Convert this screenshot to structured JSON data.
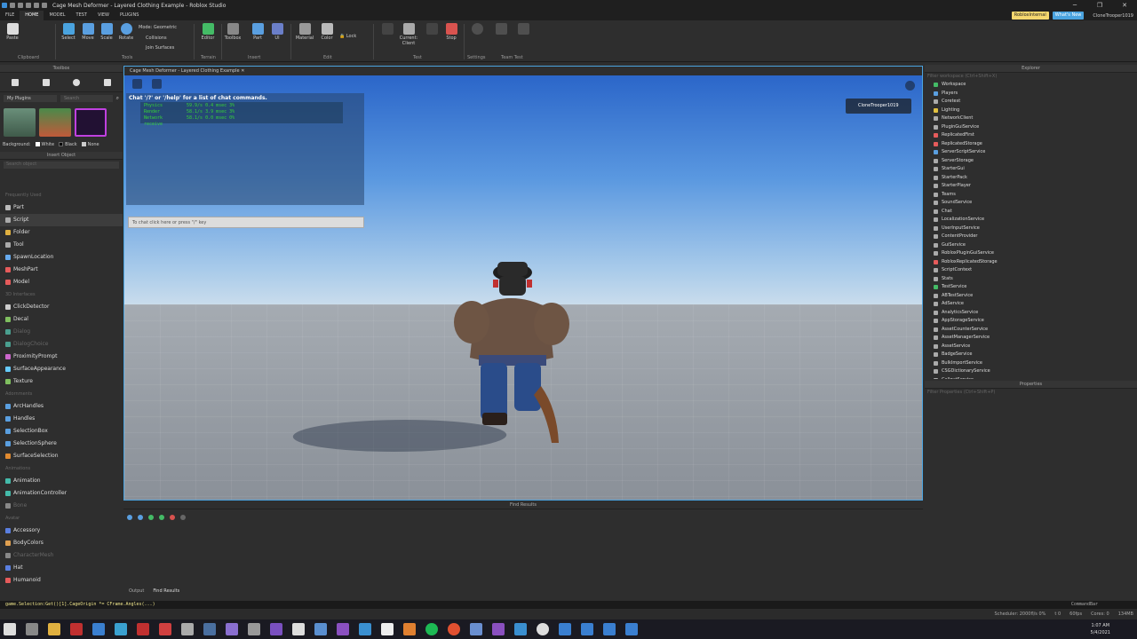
{
  "window": {
    "title": "Cage Mesh Deformer - Layered Clothing Example - Roblox Studio"
  },
  "menu": {
    "items": [
      "FILE",
      "HOME",
      "MODEL",
      "TEST",
      "VIEW",
      "PLUGINS"
    ],
    "active": "HOME",
    "badge1": "RobloxInternal",
    "badge2": "What's New",
    "user": "CloneTrooper1019"
  },
  "ribbon": {
    "paste": "Paste",
    "select": "Select",
    "move": "Move",
    "scale": "Scale",
    "rotate": "Rotate",
    "mode_label": "Mode:",
    "mode_value": "Geometric",
    "collisions": "Collisions",
    "join": "Join Surfaces",
    "editor": "Editor",
    "toolbox": "Toolbox",
    "part": "Part",
    "ui": "UI",
    "material": "Material",
    "color": "Color",
    "lock": "Lock",
    "current_client": "Current: Client",
    "stop": "Stop",
    "groups": {
      "clipboard": "Clipboard",
      "tools": "Tools",
      "terrain": "Terrain",
      "insert": "Insert",
      "edit": "Edit",
      "test": "Test",
      "settings": "Settings",
      "team_test": "Team Test"
    }
  },
  "toolbox": {
    "header": "Toolbox",
    "category": "My Plugins",
    "search_placeholder": "Search",
    "background_label": "Background:",
    "bg_options": [
      "White",
      "Black",
      "None"
    ]
  },
  "insert_object": {
    "header": "Insert Object",
    "search_placeholder": "Search object",
    "items": [
      {
        "label": "Frequently Used",
        "type": "section"
      },
      {
        "label": "Part",
        "type": "item",
        "color": "#bbbbbb"
      },
      {
        "label": "Script",
        "type": "item",
        "color": "#aaaaaa",
        "selected": true
      },
      {
        "label": "Folder",
        "type": "item",
        "color": "#e0b040"
      },
      {
        "label": "Tool",
        "type": "item",
        "color": "#aaaaaa"
      },
      {
        "label": "SpawnLocation",
        "type": "item",
        "color": "#66aaee"
      },
      {
        "label": "MeshPart",
        "type": "item",
        "color": "#e65b5b"
      },
      {
        "label": "Model",
        "type": "item",
        "color": "#e65b5b"
      },
      {
        "label": "3D Interfaces",
        "type": "section"
      },
      {
        "label": "ClickDetector",
        "type": "item",
        "color": "#cccccc"
      },
      {
        "label": "Decal",
        "type": "item",
        "color": "#7fbf5f"
      },
      {
        "label": "Dialog",
        "type": "dim",
        "color": "#4a9f8f"
      },
      {
        "label": "DialogChoice",
        "type": "dim",
        "color": "#4a9f8f"
      },
      {
        "label": "ProximityPrompt",
        "type": "item",
        "color": "#cc66cc"
      },
      {
        "label": "SurfaceAppearance",
        "type": "item",
        "color": "#66ccff"
      },
      {
        "label": "Texture",
        "type": "item",
        "color": "#7fbf5f"
      },
      {
        "label": "Adornments",
        "type": "section"
      },
      {
        "label": "ArcHandles",
        "type": "item",
        "color": "#5a9fe0"
      },
      {
        "label": "Handles",
        "type": "item",
        "color": "#5a9fe0"
      },
      {
        "label": "SelectionBox",
        "type": "item",
        "color": "#5a9fe0"
      },
      {
        "label": "SelectionSphere",
        "type": "item",
        "color": "#5a9fe0"
      },
      {
        "label": "SurfaceSelection",
        "type": "item",
        "color": "#e08a30"
      },
      {
        "label": "Animations",
        "type": "section"
      },
      {
        "label": "Animation",
        "type": "item",
        "color": "#44bbaa"
      },
      {
        "label": "AnimationController",
        "type": "item",
        "color": "#44bbaa"
      },
      {
        "label": "Bone",
        "type": "dim",
        "color": "#888888"
      },
      {
        "label": "Avatar",
        "type": "section"
      },
      {
        "label": "Accessory",
        "type": "item",
        "color": "#5a7fe0"
      },
      {
        "label": "BodyColors",
        "type": "item",
        "color": "#e0a050"
      },
      {
        "label": "CharacterMesh",
        "type": "dim",
        "color": "#888888"
      },
      {
        "label": "Hat",
        "type": "item",
        "color": "#5a7fe0"
      },
      {
        "label": "Humanoid",
        "type": "item",
        "color": "#e65b5b"
      }
    ]
  },
  "viewport": {
    "tab_title": "Cage Mesh Deformer - Layered Clothing Example",
    "chat_title": "Chat '/?' or '/help' for a list of chat commands.",
    "stats": [
      {
        "name": "Physics",
        "value": "59.9/s 0.4 msec 3%"
      },
      {
        "name": "Render",
        "value": "58.1/s 3.9 msec 3%"
      },
      {
        "name": "Network receive",
        "value": "58.1/s 0.0 msec 0%"
      }
    ],
    "chat_input": "To chat click here or press \"/\" key",
    "player_name": "CloneTrooper1019"
  },
  "find_results": {
    "header": "Find Results",
    "tabs": [
      "Output",
      "Find Results"
    ]
  },
  "explorer": {
    "header": "Explorer",
    "filter_placeholder": "Filter workspace (Ctrl+Shift+X)",
    "items": [
      {
        "label": "Workspace",
        "color": "#44bb66"
      },
      {
        "label": "Players",
        "color": "#5a9fe0"
      },
      {
        "label": "Coretest",
        "color": "#aaaaaa"
      },
      {
        "label": "Lighting",
        "color": "#e0c040"
      },
      {
        "label": "NetworkClient",
        "color": "#aaaaaa"
      },
      {
        "label": "PluginGuiService",
        "color": "#aaaaaa"
      },
      {
        "label": "ReplicatedFirst",
        "color": "#e65b5b"
      },
      {
        "label": "ReplicatedStorage",
        "color": "#e65b5b"
      },
      {
        "label": "ServerScriptService",
        "color": "#5a9fe0"
      },
      {
        "label": "ServerStorage",
        "color": "#aaaaaa"
      },
      {
        "label": "StarterGui",
        "color": "#aaaaaa"
      },
      {
        "label": "StarterPack",
        "color": "#aaaaaa"
      },
      {
        "label": "StarterPlayer",
        "color": "#aaaaaa"
      },
      {
        "label": "Teams",
        "color": "#aaaaaa"
      },
      {
        "label": "SoundService",
        "color": "#aaaaaa"
      },
      {
        "label": "Chat",
        "color": "#aaaaaa"
      },
      {
        "label": "LocalizationService",
        "color": "#aaaaaa"
      },
      {
        "label": "UserInputService",
        "color": "#aaaaaa"
      },
      {
        "label": "ContentProvider",
        "color": "#aaaaaa"
      },
      {
        "label": "GuiService",
        "color": "#aaaaaa"
      },
      {
        "label": "RobloxPluginGuiService",
        "color": "#aaaaaa"
      },
      {
        "label": "RobloxReplicatedStorage",
        "color": "#e65b5b"
      },
      {
        "label": "ScriptContext",
        "color": "#aaaaaa"
      },
      {
        "label": "Stats",
        "color": "#aaaaaa"
      },
      {
        "label": "TestService",
        "color": "#44bb66"
      },
      {
        "label": "ABTestService",
        "color": "#aaaaaa"
      },
      {
        "label": "AdService",
        "color": "#aaaaaa"
      },
      {
        "label": "AnalyticsService",
        "color": "#aaaaaa"
      },
      {
        "label": "AppStorageService",
        "color": "#aaaaaa"
      },
      {
        "label": "AssetCounterService",
        "color": "#aaaaaa"
      },
      {
        "label": "AssetManagerService",
        "color": "#aaaaaa"
      },
      {
        "label": "AssetService",
        "color": "#aaaaaa"
      },
      {
        "label": "BadgeService",
        "color": "#aaaaaa"
      },
      {
        "label": "BulkImportService",
        "color": "#aaaaaa"
      },
      {
        "label": "CSGDictionaryService",
        "color": "#aaaaaa"
      },
      {
        "label": "CalloutService",
        "color": "#aaaaaa"
      }
    ]
  },
  "properties": {
    "header": "Properties",
    "filter_placeholder": "Filter Properties (Ctrl+Shift+P)"
  },
  "command_bar": {
    "text": "game.Selection:Get()[1].CageOrigin *= CFrame.Angles(...)",
    "label": "CommandBar"
  },
  "status": {
    "scheduler": "Scheduler: 2000fl/s 0%",
    "frame": "t 0",
    "fps": "60fps",
    "cores": "Cores: 0",
    "mem": "134MB"
  },
  "clock": {
    "time": "1:07 AM",
    "date": "5/4/2021"
  },
  "colors": {
    "accent": "#4aa3df",
    "panel": "#2e2e2e",
    "stats_text": "#37d437",
    "badge1": "#f5d76e",
    "badge2": "#4aa3df"
  }
}
